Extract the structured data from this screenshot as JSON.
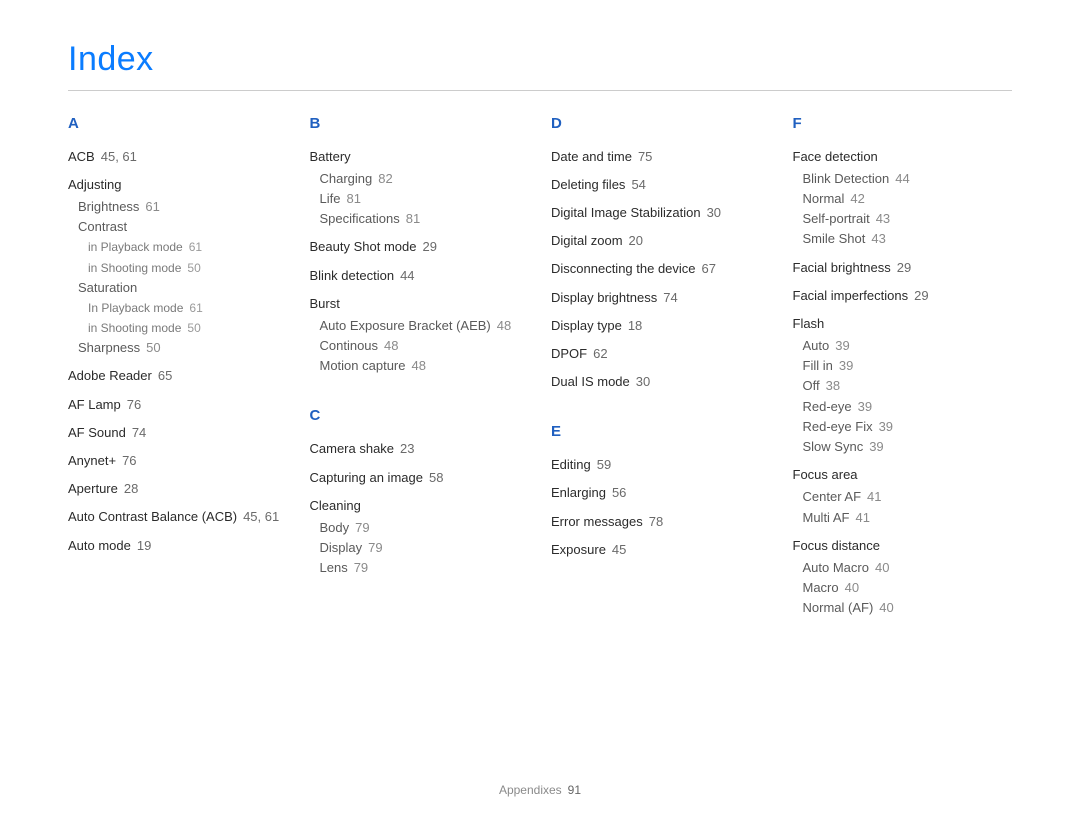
{
  "title": "Index",
  "footer": {
    "section": "Appendixes",
    "page": "91"
  },
  "columns": [
    {
      "groups": [
        {
          "letter": "A",
          "entries": [
            {
              "term": "ACB",
              "pages": "45, 61"
            },
            {
              "term": "Adjusting",
              "subs": [
                {
                  "term": "Brightness",
                  "pages": "61"
                },
                {
                  "term": "Contrast",
                  "subs": [
                    {
                      "term": "in Playback mode",
                      "pages": "61"
                    },
                    {
                      "term": "in Shooting mode",
                      "pages": "50"
                    }
                  ]
                },
                {
                  "term": "Saturation",
                  "subs": [
                    {
                      "term": "In Playback mode",
                      "pages": "61"
                    },
                    {
                      "term": "in Shooting mode",
                      "pages": "50"
                    }
                  ]
                },
                {
                  "term": "Sharpness",
                  "pages": "50"
                }
              ]
            },
            {
              "term": "Adobe Reader",
              "pages": "65"
            },
            {
              "term": "AF Lamp",
              "pages": "76"
            },
            {
              "term": "AF Sound",
              "pages": "74"
            },
            {
              "term": "Anynet+",
              "pages": "76"
            },
            {
              "term": "Aperture",
              "pages": "28"
            },
            {
              "term": "Auto Contrast Balance (ACB)",
              "pages": "45, 61"
            },
            {
              "term": "Auto mode",
              "pages": "19"
            }
          ]
        }
      ]
    },
    {
      "groups": [
        {
          "letter": "B",
          "entries": [
            {
              "term": "Battery",
              "subs": [
                {
                  "term": "Charging",
                  "pages": "82"
                },
                {
                  "term": "Life",
                  "pages": "81"
                },
                {
                  "term": "Specifications",
                  "pages": "81"
                }
              ]
            },
            {
              "term": "Beauty Shot mode",
              "pages": "29"
            },
            {
              "term": "Blink detection",
              "pages": "44"
            },
            {
              "term": "Burst",
              "subs": [
                {
                  "term": "Auto Exposure Bracket (AEB)",
                  "pages": "48"
                },
                {
                  "term": "Continous",
                  "pages": "48"
                },
                {
                  "term": "Motion capture",
                  "pages": "48"
                }
              ]
            }
          ]
        },
        {
          "letter": "C",
          "entries": [
            {
              "term": "Camera shake",
              "pages": "23"
            },
            {
              "term": "Capturing an image",
              "pages": "58"
            },
            {
              "term": "Cleaning",
              "subs": [
                {
                  "term": "Body",
                  "pages": "79"
                },
                {
                  "term": "Display",
                  "pages": "79"
                },
                {
                  "term": "Lens",
                  "pages": "79"
                }
              ]
            }
          ]
        }
      ]
    },
    {
      "groups": [
        {
          "letter": "D",
          "entries": [
            {
              "term": "Date and time",
              "pages": "75"
            },
            {
              "term": "Deleting files",
              "pages": "54"
            },
            {
              "term": "Digital Image Stabilization",
              "pages": "30"
            },
            {
              "term": "Digital zoom",
              "pages": "20"
            },
            {
              "term": "Disconnecting the device",
              "pages": "67"
            },
            {
              "term": "Display brightness",
              "pages": "74"
            },
            {
              "term": "Display type",
              "pages": "18"
            },
            {
              "term": "DPOF",
              "pages": "62"
            },
            {
              "term": "Dual IS mode",
              "pages": "30"
            }
          ]
        },
        {
          "letter": "E",
          "entries": [
            {
              "term": "Editing",
              "pages": "59"
            },
            {
              "term": "Enlarging",
              "pages": "56"
            },
            {
              "term": "Error messages",
              "pages": "78"
            },
            {
              "term": "Exposure",
              "pages": "45"
            }
          ]
        }
      ]
    },
    {
      "groups": [
        {
          "letter": "F",
          "entries": [
            {
              "term": "Face detection",
              "subs": [
                {
                  "term": "Blink Detection",
                  "pages": "44"
                },
                {
                  "term": "Normal",
                  "pages": "42"
                },
                {
                  "term": "Self-portrait",
                  "pages": "43"
                },
                {
                  "term": "Smile Shot",
                  "pages": "43"
                }
              ]
            },
            {
              "term": "Facial brightness",
              "pages": "29"
            },
            {
              "term": "Facial imperfections",
              "pages": "29"
            },
            {
              "term": "Flash",
              "subs": [
                {
                  "term": "Auto",
                  "pages": "39"
                },
                {
                  "term": "Fill in",
                  "pages": "39"
                },
                {
                  "term": "Off",
                  "pages": "38"
                },
                {
                  "term": "Red-eye",
                  "pages": "39"
                },
                {
                  "term": "Red-eye Fix",
                  "pages": "39"
                },
                {
                  "term": "Slow Sync",
                  "pages": "39"
                }
              ]
            },
            {
              "term": "Focus area",
              "subs": [
                {
                  "term": "Center AF",
                  "pages": "41"
                },
                {
                  "term": "Multi AF",
                  "pages": "41"
                }
              ]
            },
            {
              "term": "Focus distance",
              "subs": [
                {
                  "term": "Auto Macro",
                  "pages": "40"
                },
                {
                  "term": "Macro",
                  "pages": "40"
                },
                {
                  "term": "Normal (AF)",
                  "pages": "40"
                }
              ]
            }
          ]
        }
      ]
    }
  ]
}
